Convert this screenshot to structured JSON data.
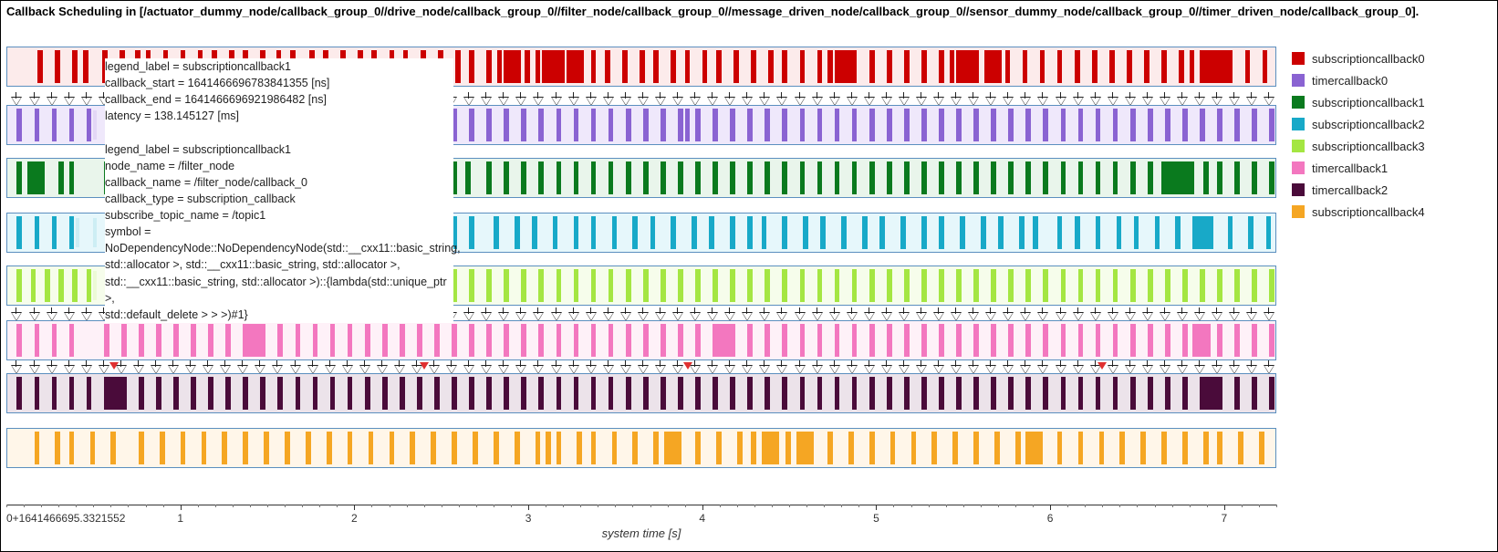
{
  "title": "Callback Scheduling in [/actuator_dummy_node/callback_group_0//drive_node/callback_group_0//filter_node/callback_group_0//message_driven_node/callback_group_0//sensor_dummy_node/callback_group_0//timer_driven_node/callback_group_0].",
  "xaxis": {
    "title": "system time [s]",
    "origin_label": "0+1641466695.3321552",
    "major_ticks": [
      1,
      2,
      3,
      4,
      5,
      6,
      7
    ],
    "range": [
      0.0,
      7.3
    ]
  },
  "legend": [
    {
      "label": "subscriptioncallback0",
      "color": "#cc0000"
    },
    {
      "label": "timercallback0",
      "color": "#8a63d2"
    },
    {
      "label": "subscriptioncallback1",
      "color": "#0a7a1e"
    },
    {
      "label": "subscriptioncallback2",
      "color": "#18a9c8"
    },
    {
      "label": "subscriptioncallback3",
      "color": "#a4e642"
    },
    {
      "label": "timercallback1",
      "color": "#f377bf"
    },
    {
      "label": "timercallback2",
      "color": "#4a0b3a"
    },
    {
      "label": "subscriptioncallback4",
      "color": "#f5a623"
    }
  ],
  "tooltip": {
    "lines1": [
      "legend_label = subscriptioncallback1",
      "callback_start = 1641466696783841355 [ns]",
      "callback_end = 1641466696921986482 [ns]",
      "latency = 138.145127 [ms]"
    ],
    "lines2": [
      "legend_label = subscriptioncallback1",
      "node_name = /filter_node",
      "callback_name = /filter_node/callback_0",
      "callback_type = subscription_callback",
      "subscribe_topic_name = /topic1",
      "symbol =",
      "NoDependencyNode::NoDependencyNode(std::__cxx11::basic_string,",
      "std::allocator >, std::__cxx11::basic_string, std::allocator >,",
      "std::__cxx11::basic_string, std::allocator >)::{lambda(std::unique_ptr >,",
      "std::default_delete > > >)#1}"
    ]
  },
  "chart_data": {
    "type": "other",
    "title": "Callback Scheduling timeline (8 lanes)",
    "xlabel": "system time [s]",
    "x_range": [
      0.0,
      7.3
    ],
    "hover_x": 1.518,
    "hover_lane": 2,
    "lanes": [
      {
        "name": "subscriptioncallback0",
        "color": "#cc0000",
        "bg": "#fcebeb",
        "arrows": false,
        "red_markers": [],
        "events": [
          0.18,
          0.28,
          0.38,
          0.44,
          0.55,
          0.65,
          0.74,
          0.8,
          0.9,
          1.0,
          1.1,
          1.18,
          1.28,
          1.36,
          1.46,
          1.55,
          1.63,
          1.74,
          1.82,
          1.92,
          2.02,
          2.1,
          2.2,
          2.28,
          2.38,
          2.48,
          2.58,
          2.66,
          2.76,
          2.82,
          2.86,
          2.9,
          2.98,
          3.04,
          3.08,
          3.12,
          3.18,
          3.22,
          3.28,
          3.36,
          3.44,
          3.54,
          3.64,
          3.72,
          3.82,
          3.9,
          4.0,
          4.08,
          4.18,
          4.28,
          4.38,
          4.46,
          4.56,
          4.66,
          4.72,
          4.76,
          4.8,
          4.86,
          4.96,
          5.06,
          5.16,
          5.26,
          5.36,
          5.42,
          5.46,
          5.5,
          5.56,
          5.62,
          5.66,
          5.74,
          5.84,
          5.94,
          6.04,
          6.14,
          6.24,
          6.34,
          6.44,
          6.54,
          6.64,
          6.74,
          6.8,
          6.86,
          6.9,
          6.94,
          7.02,
          7.12,
          7.22
        ],
        "widths": {
          "2.86": 0.1,
          "3.08": 0.1,
          "3.22": 0.1,
          "4.76": 0.1,
          "5.46": 0.1,
          "5.62": 0.1,
          "6.86": 0.16
        }
      },
      {
        "name": "timercallback0",
        "color": "#8a63d2",
        "bg": "#efe8fb",
        "arrows": true,
        "red_markers": [],
        "events": [
          0.06,
          0.16,
          0.26,
          0.36,
          0.46,
          2.56,
          2.66,
          2.76,
          2.86,
          2.96,
          3.06,
          3.16,
          3.26,
          3.36,
          3.46,
          3.56,
          3.66,
          3.76,
          3.86,
          3.9,
          3.96,
          4.06,
          4.16,
          4.26,
          4.36,
          4.46,
          4.56,
          4.66,
          4.76,
          4.86,
          4.96,
          5.06,
          5.16,
          5.26,
          5.36,
          5.46,
          5.56,
          5.66,
          5.76,
          5.86,
          5.96,
          6.06,
          6.16,
          6.26,
          6.36,
          6.46,
          6.56,
          6.66,
          6.76,
          6.86,
          6.96,
          7.06,
          7.16,
          7.26
        ],
        "widths": {
          "3.90": 0.12
        },
        "offscreen_between": [
          0.5,
          2.5
        ]
      },
      {
        "name": "subscriptioncallback1",
        "color": "#0a7a1e",
        "bg": "#e9f5eb",
        "arrows": false,
        "red_markers": [],
        "events": [
          0.06,
          0.12,
          0.18,
          0.3,
          0.36,
          0.56,
          0.64,
          0.74,
          0.84,
          0.94,
          1.04,
          1.14,
          1.24,
          1.34,
          1.44,
          1.48,
          1.54,
          1.64,
          1.74,
          1.84,
          1.94,
          2.04,
          2.14,
          2.24,
          2.34,
          2.4,
          2.46,
          2.56,
          2.64,
          2.76,
          2.86,
          2.96,
          3.06,
          3.16,
          3.26,
          3.36,
          3.46,
          3.56,
          3.66,
          3.76,
          3.86,
          3.96,
          4.06,
          4.16,
          4.26,
          4.36,
          4.46,
          4.56,
          4.66,
          4.76,
          4.86,
          4.96,
          5.06,
          5.16,
          5.26,
          5.36,
          5.46,
          5.56,
          5.66,
          5.76,
          5.86,
          5.96,
          6.06,
          6.16,
          6.26,
          6.36,
          6.46,
          6.56,
          6.64,
          6.72,
          6.8,
          6.88,
          6.96,
          7.06,
          7.16,
          7.26
        ],
        "widths": {
          "0.12": 0.1,
          "1.48": 0.1,
          "2.40": 0.12,
          "6.64": 0.18
        }
      },
      {
        "name": "subscriptioncallback2",
        "color": "#18a9c8",
        "bg": "#e6f7fb",
        "arrows": false,
        "red_markers": [],
        "events": [
          0.06,
          0.16,
          0.26,
          0.36,
          2.56,
          2.66,
          2.8,
          2.92,
          3.02,
          3.14,
          3.26,
          3.36,
          3.48,
          3.6,
          3.7,
          3.82,
          3.94,
          4.04,
          4.16,
          4.26,
          4.34,
          4.46,
          4.58,
          4.68,
          4.8,
          4.92,
          5.02,
          5.14,
          5.26,
          5.36,
          5.48,
          5.6,
          5.7,
          5.82,
          5.9,
          6.04,
          6.14,
          6.26,
          6.38,
          6.48,
          6.6,
          6.72,
          6.82,
          6.9,
          7.02,
          7.14,
          7.24
        ],
        "widths": {
          "6.82": 0.12
        },
        "offscreen_between": [
          0.4,
          2.5
        ]
      },
      {
        "name": "subscriptioncallback3",
        "color": "#a4e642",
        "bg": "#f6fdeb",
        "arrows": false,
        "red_markers": [],
        "events": [
          0.06,
          0.14,
          0.22,
          0.3,
          0.38,
          0.46,
          2.56,
          2.66,
          2.76,
          2.86,
          2.96,
          3.06,
          3.16,
          3.26,
          3.36,
          3.46,
          3.56,
          3.66,
          3.76,
          3.86,
          3.96,
          4.06,
          4.16,
          4.26,
          4.36,
          4.46,
          4.56,
          4.66,
          4.76,
          4.86,
          4.96,
          5.06,
          5.16,
          5.26,
          5.36,
          5.46,
          5.56,
          5.66,
          5.76,
          5.86,
          5.96,
          6.06,
          6.16,
          6.26,
          6.36,
          6.46,
          6.56,
          6.66,
          6.76,
          6.86,
          6.96,
          7.06,
          7.16,
          7.26
        ],
        "offscreen_between": [
          0.5,
          2.5
        ]
      },
      {
        "name": "timercallback1",
        "color": "#f377bf",
        "bg": "#fef1f8",
        "arrows": true,
        "red_markers": [],
        "events": [
          0.06,
          0.16,
          0.26,
          0.36,
          0.56,
          0.66,
          0.76,
          0.86,
          0.96,
          1.06,
          1.16,
          1.26,
          1.36,
          1.46,
          1.56,
          1.66,
          1.76,
          1.86,
          1.96,
          2.06,
          2.16,
          2.26,
          2.36,
          2.46,
          2.56,
          2.66,
          2.76,
          2.86,
          2.96,
          3.06,
          3.16,
          3.26,
          3.36,
          3.46,
          3.56,
          3.66,
          3.76,
          3.86,
          3.96,
          4.06,
          4.16,
          4.26,
          4.36,
          4.46,
          4.56,
          4.66,
          4.76,
          4.86,
          4.96,
          5.06,
          5.16,
          5.26,
          5.36,
          5.46,
          5.56,
          5.66,
          5.76,
          5.86,
          5.96,
          6.06,
          6.16,
          6.26,
          6.36,
          6.46,
          6.56,
          6.66,
          6.76,
          6.82,
          6.88,
          6.96,
          7.06,
          7.16,
          7.26
        ],
        "widths": {
          "1.36": 0.1,
          "4.06": 0.1,
          "6.82": 0.1
        }
      },
      {
        "name": "timercallback2",
        "color": "#4a0b3a",
        "bg": "#ece3ea",
        "arrows": true,
        "red_markers": [
          0.62,
          2.4,
          3.92,
          6.3
        ],
        "events": [
          0.06,
          0.16,
          0.26,
          0.36,
          0.46,
          0.56,
          0.66,
          0.76,
          0.86,
          0.96,
          1.06,
          1.16,
          1.26,
          1.36,
          1.46,
          1.56,
          1.66,
          1.76,
          1.86,
          1.96,
          2.06,
          2.16,
          2.26,
          2.36,
          2.46,
          2.56,
          2.66,
          2.76,
          2.86,
          2.96,
          3.06,
          3.16,
          3.26,
          3.36,
          3.46,
          3.56,
          3.66,
          3.76,
          3.86,
          3.96,
          4.06,
          4.16,
          4.26,
          4.36,
          4.46,
          4.56,
          4.66,
          4.76,
          4.86,
          4.96,
          5.06,
          5.16,
          5.26,
          5.36,
          5.46,
          5.56,
          5.66,
          5.76,
          5.86,
          5.96,
          6.06,
          6.16,
          6.26,
          6.36,
          6.46,
          6.56,
          6.66,
          6.76,
          6.86,
          6.96,
          7.06,
          7.16,
          7.26
        ],
        "widths": {
          "0.56": 0.1,
          "6.86": 0.1
        }
      },
      {
        "name": "subscriptioncallback4",
        "color": "#f5a623",
        "bg": "#fff6e9",
        "arrows": false,
        "red_markers": [],
        "events": [
          0.16,
          0.28,
          0.36,
          0.48,
          0.6,
          0.76,
          0.88,
          1.0,
          1.12,
          1.24,
          1.36,
          1.48,
          1.6,
          1.72,
          1.84,
          1.96,
          2.08,
          2.2,
          2.32,
          2.44,
          2.56,
          2.68,
          2.8,
          2.92,
          3.04,
          3.1,
          3.16,
          3.28,
          3.36,
          3.48,
          3.6,
          3.72,
          3.78,
          3.84,
          3.96,
          4.08,
          4.2,
          4.28,
          4.34,
          4.4,
          4.48,
          4.54,
          4.6,
          4.72,
          4.84,
          4.96,
          5.08,
          5.2,
          5.32,
          5.44,
          5.56,
          5.68,
          5.8,
          5.86,
          5.92,
          6.04,
          6.16,
          6.28,
          6.4,
          6.52,
          6.64,
          6.76,
          6.88,
          6.96,
          7.08,
          7.2
        ],
        "widths": {
          "3.10": 0.1,
          "3.78": 0.1,
          "4.34": 0.1,
          "4.54": 0.1,
          "5.86": 0.1
        }
      }
    ]
  }
}
